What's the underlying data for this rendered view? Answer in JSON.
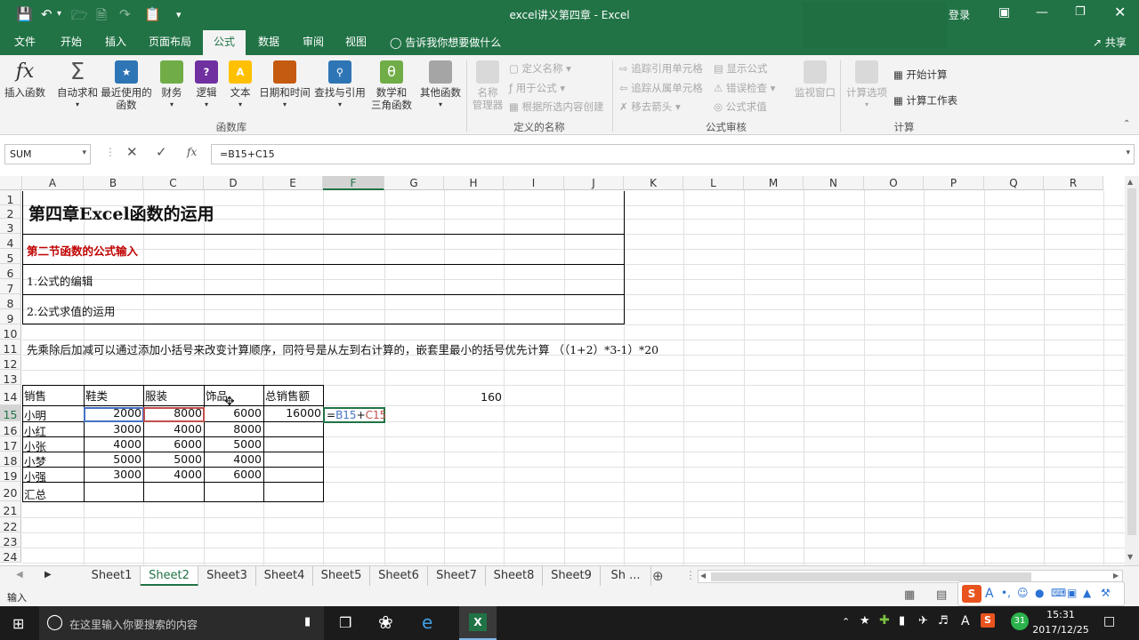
{
  "titlebar": {
    "title": "excel讲义第四章  -  Excel",
    "login": "登录"
  },
  "tabs": [
    "文件",
    "开始",
    "插入",
    "页面布局",
    "公式",
    "数据",
    "审阅",
    "视图"
  ],
  "active_tab": "公式",
  "tell_me": "告诉我你想要做什么",
  "share": "共享",
  "ribbon": {
    "insert_fn": "插入函数",
    "autosum": "自动求和",
    "recent": "最近使用的\n函数",
    "finance": "财务",
    "logic": "逻辑",
    "text": "文本",
    "datetime": "日期和时间",
    "lookup": "查找与引用",
    "math": "数学和\n三角函数",
    "other": "其他函数",
    "group_lib": "函数库",
    "name_mgr": "名称\n管理器",
    "define_name": "定义名称",
    "use_in_formula": "用于公式",
    "create_from_sel": "根据所选内容创建",
    "group_names": "定义的名称",
    "trace_prec": "追踪引用单元格",
    "trace_dep": "追踪从属单元格",
    "remove_arrows": "移去箭头",
    "show_formulas": "显示公式",
    "error_check": "错误检查",
    "eval_formula": "公式求值",
    "group_audit": "公式审核",
    "watch": "监视窗口",
    "calc_options": "计算选项",
    "calc_now": "开始计算",
    "calc_sheet": "计算工作表",
    "group_calc": "计算"
  },
  "formula_bar": {
    "name_box": "SUM",
    "fx": "fx",
    "formula": "=B15+C15"
  },
  "columns": [
    "A",
    "B",
    "C",
    "D",
    "E",
    "F",
    "G",
    "H",
    "I",
    "J",
    "K",
    "L",
    "M",
    "N",
    "O",
    "P",
    "Q",
    "R"
  ],
  "rows": [
    "1",
    "2",
    "3",
    "4",
    "5",
    "6",
    "7",
    "8",
    "9",
    "10",
    "11",
    "12",
    "13",
    "14",
    "15",
    "16",
    "17",
    "18",
    "19",
    "20",
    "21",
    "22",
    "23",
    "24"
  ],
  "cells": {
    "title": "第四章Excel函数的运用",
    "section": "第二节函数的公式输入",
    "item1": "1.公式的编辑",
    "item2": "2.公式求值的运用",
    "note": "先乘除后加减可以通过添加小括号来改变计算顺序，同符号是从左到右计算的，嵌套里最小的括号优先计算 （（1+2）*3-1）*20",
    "h14": "160",
    "table_header": [
      "销售",
      "鞋类",
      "服装",
      "饰品",
      "总销售额"
    ],
    "table_rows": [
      [
        "小明",
        "2000",
        "8000",
        "6000",
        "16000"
      ],
      [
        "小红",
        "3000",
        "4000",
        "8000",
        ""
      ],
      [
        "小张",
        "4000",
        "6000",
        "5000",
        ""
      ],
      [
        "小梦",
        "5000",
        "5000",
        "4000",
        ""
      ],
      [
        "小强",
        "3000",
        "4000",
        "6000",
        ""
      ]
    ],
    "total_label": "汇总",
    "f15_eq": "=",
    "f15_b": "B15",
    "f15_plus": "+",
    "f15_c": "C15"
  },
  "sheets": [
    "Sheet1",
    "Sheet2",
    "Sheet3",
    "Sheet4",
    "Sheet5",
    "Sheet6",
    "Sheet7",
    "Sheet8",
    "Sheet9",
    "Sh ..."
  ],
  "active_sheet": "Sheet2",
  "status": "输入",
  "taskbar": {
    "search": "在这里输入你要搜索的内容",
    "time": "15:31",
    "date": "2017/12/25",
    "ime": "A",
    "badge": "31"
  },
  "colors": {
    "excel_green": "#217346",
    "ref_blue": "#4472c4",
    "ref_red": "#c0504d",
    "section_red": "#c00000"
  }
}
